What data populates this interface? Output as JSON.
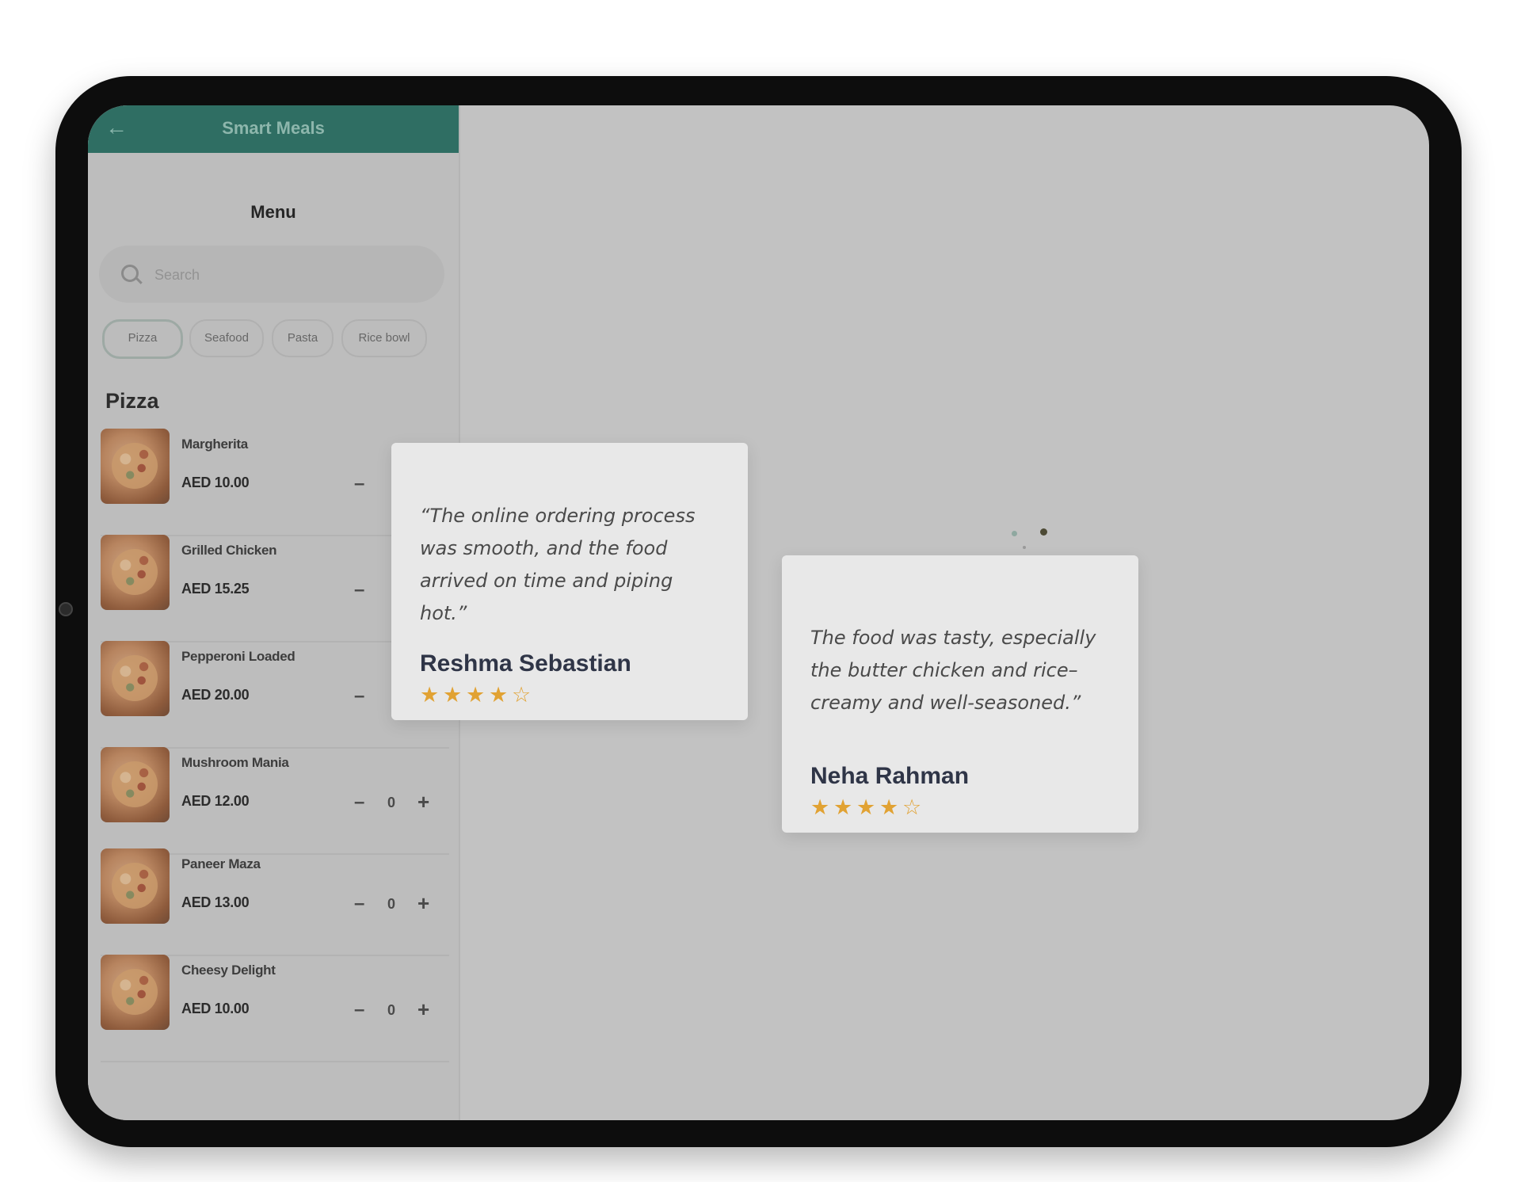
{
  "app": {
    "title": "Smart Meals",
    "back_icon": "arrow-left-icon"
  },
  "menu": {
    "title": "Menu",
    "search_placeholder": "Search",
    "categories": [
      "Pizza",
      "Seafood",
      "Pasta",
      "Rice bowl"
    ],
    "active_category": "Pizza",
    "section_title": "Pizza",
    "items": [
      {
        "name": "Margherita",
        "price": "AED 10.00",
        "qty": ""
      },
      {
        "name": "Grilled Chicken",
        "price": "AED 15.25",
        "qty": ""
      },
      {
        "name": "Pepperoni Loaded",
        "price": "AED 20.00",
        "qty": ""
      },
      {
        "name": "Mushroom Mania",
        "price": "AED 12.00",
        "qty": "0"
      },
      {
        "name": "Paneer Maza",
        "price": "AED 13.00",
        "qty": "0"
      },
      {
        "name": "Cheesy Delight",
        "price": "AED 10.00",
        "qty": "0"
      }
    ]
  },
  "reviews": [
    {
      "quote": "“The online ordering process was smooth, and the food arrived on time and piping hot.”",
      "name": "Reshma Sebastian",
      "rating": 4,
      "max_rating": 5
    },
    {
      "quote": "The food was tasty, especially the butter chicken and rice–creamy and well-seasoned.”",
      "name": "Neha Rahman",
      "rating": 4,
      "max_rating": 5
    }
  ],
  "colors": {
    "appbar": "#2f6e63",
    "star": "#e1a233",
    "reviewer_name": "#2f3547"
  }
}
